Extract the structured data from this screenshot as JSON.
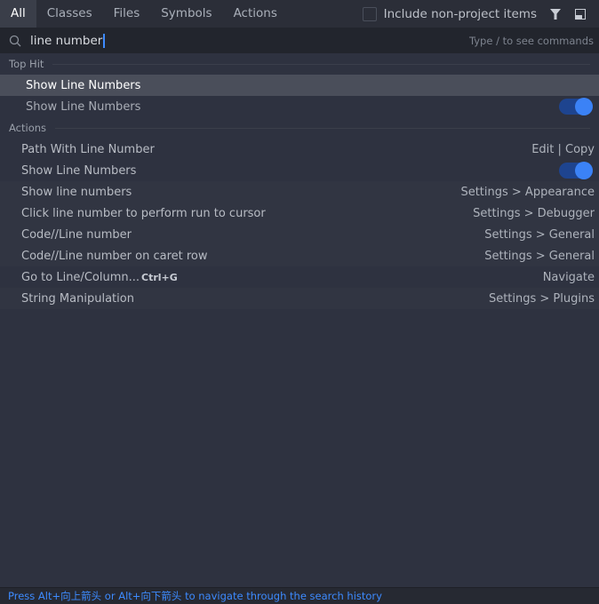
{
  "tabs": [
    "All",
    "Classes",
    "Files",
    "Symbols",
    "Actions"
  ],
  "include_label": "Include non-project items",
  "icons": {
    "filter": "filter-icon",
    "preview": "preview-panel-icon",
    "search": "search-icon"
  },
  "search": {
    "value": "line number",
    "hint": "Type / to see commands"
  },
  "sections": {
    "top_hit": "Top Hit",
    "actions": "Actions"
  },
  "top_hit": [
    {
      "label": "Show Line Numbers",
      "selected": true
    },
    {
      "label": "Show Line Numbers",
      "toggle": true
    }
  ],
  "actions": [
    {
      "label": "Path With Line Number",
      "right": "Edit | Copy"
    },
    {
      "label": "Show Line Numbers",
      "toggle": true
    },
    {
      "label": "Show line numbers",
      "right": "Settings > Appearance"
    },
    {
      "label": "Click line number to perform run to cursor",
      "right": "Settings > Debugger"
    },
    {
      "label": "Code//Line number",
      "right": "Settings > General"
    },
    {
      "label": "Code//Line number on caret row",
      "right": "Settings > General"
    },
    {
      "label": "Go to Line/Column...",
      "shortcut": "Ctrl+G",
      "right": "Navigate"
    },
    {
      "label": "String Manipulation",
      "right": "Settings > Plugins"
    }
  ],
  "footer": "Press Alt+向上箭头 or Alt+向下箭头 to navigate through the search history",
  "colors": {
    "accent": "#3d8bff",
    "toggle_on": "#3b82f6"
  }
}
